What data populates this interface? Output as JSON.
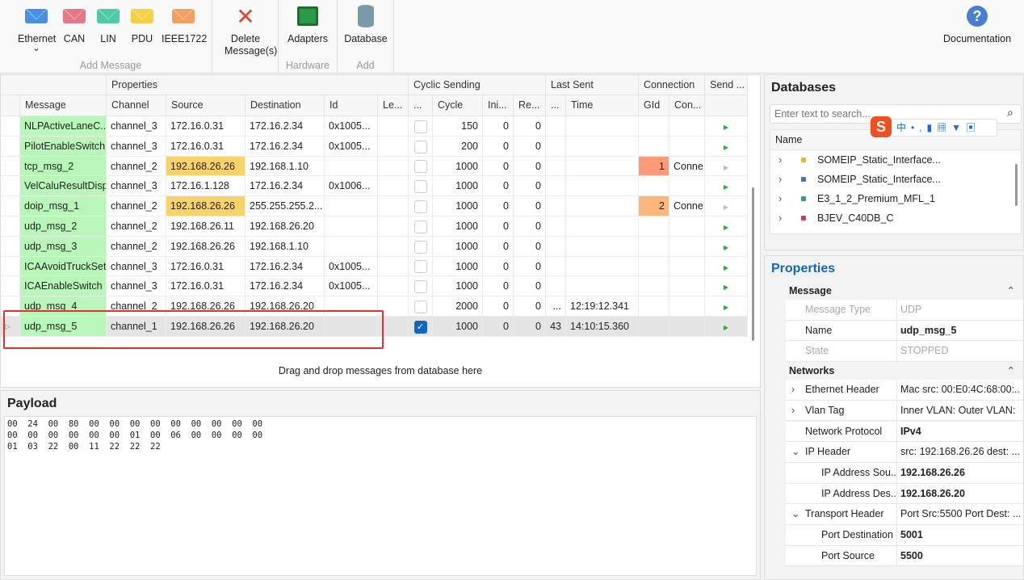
{
  "ribbon": {
    "groups": [
      {
        "label": "Add Message"
      },
      {
        "label": ""
      },
      {
        "label": "Hardware"
      },
      {
        "label": "Add"
      }
    ],
    "buttons": [
      {
        "label": "Ethernet",
        "icon": "ethernet-envelope-icon",
        "color": "#4a90e2",
        "dropdown": "⌄"
      },
      {
        "label": "CAN",
        "icon": "can-envelope-icon",
        "color": "#e57886"
      },
      {
        "label": "LIN",
        "icon": "lin-envelope-icon",
        "color": "#4fc9a8"
      },
      {
        "label": "PDU",
        "icon": "pdu-envelope-icon",
        "color": "#f4d046"
      },
      {
        "label": "IEEE1722",
        "icon": "ieee1722-envelope-icon",
        "color": "#f0a060"
      },
      {
        "label": "Delete Message(s)",
        "icon": "delete-x-icon",
        "color": "#e0452a"
      },
      {
        "label": "Adapters",
        "icon": "circuit-board-icon",
        "color": "#2a9a48"
      },
      {
        "label": "Database",
        "icon": "database-icon",
        "color": "#7a9aaa"
      },
      {
        "label": "Documentation",
        "icon": "help-icon",
        "color": "#4a7ed0"
      }
    ]
  },
  "grid": {
    "groups": [
      "Properties",
      "Cyclic Sending",
      "Last Sent",
      "Connection",
      "Send ..."
    ],
    "columns": [
      "Message",
      "Channel",
      "Source",
      "Destination",
      "Id",
      "Le...",
      "...",
      "Cycle",
      "Ini...",
      "Re...",
      "...",
      "Time",
      "GId",
      "Con..."
    ],
    "rows": [
      {
        "name": "NLPActiveLaneC...",
        "channel": "channel_3",
        "source": "172.16.0.31",
        "dest": "172.16.2.34",
        "id": "0x1005...",
        "cyclic": false,
        "cycle": "150",
        "ini": "0",
        "re": "0",
        "count": "",
        "time": "",
        "gid": "",
        "con": ""
      },
      {
        "name": "PilotEnableSwitch",
        "channel": "channel_3",
        "source": "172.16.0.31",
        "dest": "172.16.2.34",
        "id": "0x1005...",
        "cyclic": false,
        "cycle": "200",
        "ini": "0",
        "re": "0",
        "count": "",
        "time": "",
        "gid": "",
        "con": ""
      },
      {
        "name": "tcp_msg_2",
        "channel": "channel_2",
        "source": "192.168.26.26",
        "source_hl": true,
        "dest": "192.168.1.10",
        "id": "",
        "cyclic": false,
        "cycle": "1000",
        "ini": "0",
        "re": "0",
        "count": "",
        "time": "",
        "gid": "1",
        "gid_color": "#fd9a78",
        "con": "Conne",
        "send_disabled": true
      },
      {
        "name": "VelCaluResultDisp",
        "channel": "channel_3",
        "source": "172.16.1.128",
        "dest": "172.16.2.34",
        "id": "0x1006...",
        "cyclic": false,
        "cycle": "1000",
        "ini": "0",
        "re": "0",
        "count": "",
        "time": "",
        "gid": "",
        "con": ""
      },
      {
        "name": "doip_msg_1",
        "channel": "channel_2",
        "source": "192.168.26.26",
        "source_hl": true,
        "dest": "255.255.255.2...",
        "id": "",
        "cyclic": false,
        "cycle": "1000",
        "ini": "0",
        "re": "0",
        "count": "",
        "time": "",
        "gid": "2",
        "gid_color": "#fdb77a",
        "con": "Conne",
        "send_disabled": true
      },
      {
        "name": "udp_msg_2",
        "channel": "channel_2",
        "source": "192.168.26.11",
        "dest": "192.168.26.20",
        "id": "",
        "cyclic": false,
        "cycle": "1000",
        "ini": "0",
        "re": "0",
        "count": "",
        "time": "",
        "gid": "",
        "con": ""
      },
      {
        "name": "udp_msg_3",
        "channel": "channel_2",
        "source": "192.168.26.26",
        "dest": "192.168.1.10",
        "id": "",
        "cyclic": false,
        "cycle": "1000",
        "ini": "0",
        "re": "0",
        "count": "",
        "time": "",
        "gid": "",
        "con": ""
      },
      {
        "name": "ICAAvoidTruckSet",
        "channel": "channel_3",
        "source": "172.16.0.31",
        "dest": "172.16.2.34",
        "id": "0x1005...",
        "cyclic": false,
        "cycle": "1000",
        "ini": "0",
        "re": "0",
        "count": "",
        "time": "",
        "gid": "",
        "con": ""
      },
      {
        "name": "ICAEnableSwitch",
        "channel": "channel_3",
        "source": "172.16.0.31",
        "dest": "172.16.2.34",
        "id": "0x1005...",
        "cyclic": false,
        "cycle": "1000",
        "ini": "0",
        "re": "0",
        "count": "",
        "time": "",
        "gid": "",
        "con": ""
      },
      {
        "name": "udp_msg_4",
        "channel": "channel_2",
        "source": "192.168.26.26",
        "dest": "192.168.26.20",
        "id": "",
        "cyclic": false,
        "cycle": "2000",
        "ini": "0",
        "re": "0",
        "count": "...",
        "time": "12:19:12.341",
        "gid": "",
        "con": ""
      },
      {
        "name": "udp_msg_5",
        "channel": "channel_1",
        "source": "192.168.26.26",
        "dest": "192.168.26.20",
        "id": "",
        "cyclic": true,
        "cycle": "1000",
        "ini": "0",
        "re": "0",
        "count": "43",
        "time": "14:10:15.360",
        "gid": "",
        "con": "",
        "selected": true
      }
    ],
    "drop_hint": "Drag and drop messages from database here"
  },
  "payload": {
    "title": "Payload",
    "text": "00  24  00  80  00  00  00  00  00  00  00  00  00\n00  00  00  00  00  00  01  00  06  00  00  00  00\n01  03  22  00  11  22  22  22"
  },
  "databases": {
    "title": "Databases",
    "search_placeholder": "Enter text to search...",
    "column": "Name",
    "items": [
      {
        "label": "SOMEIP_Static_Interface...",
        "color": "#e8b830"
      },
      {
        "label": "SOMEIP_Static_Interface...",
        "color": "#4a70c8"
      },
      {
        "label": "E3_1_2_Premium_MFL_1",
        "color": "#2aa080"
      },
      {
        "label": "BJEV_C40DB_C",
        "color": "#d04050"
      }
    ]
  },
  "properties": {
    "title": "Properties",
    "sections": [
      {
        "label": "Message",
        "rows": [
          {
            "key": "Message Type",
            "value": "UDP",
            "muted": true
          },
          {
            "key": "Name",
            "value": "udp_msg_5",
            "bold": true
          },
          {
            "key": "State",
            "value": "STOPPED",
            "muted": true
          }
        ]
      },
      {
        "label": "Networks",
        "rows": [
          {
            "key": "Ethernet Header",
            "value": "Mac src: 00:E0:4C:68:00:...",
            "exp": ">"
          },
          {
            "key": "Vlan Tag",
            "value": "Inner VLAN:  Outer VLAN:",
            "exp": ">"
          },
          {
            "key": "Network Protocol",
            "value": "IPv4",
            "bold": true
          },
          {
            "key": "IP Header",
            "value": "src: 192.168.26.26 dest: ...",
            "exp": "⌄"
          },
          {
            "key": "IP Address Sou...",
            "value": "192.168.26.26",
            "bold": true,
            "indent": true
          },
          {
            "key": "IP Address Des...",
            "value": "192.168.26.20",
            "bold": true,
            "indent": true
          },
          {
            "key": "Transport Header",
            "value": "Port Src:5500 Port Dest: ...",
            "exp": "⌄"
          },
          {
            "key": "Port Destination",
            "value": "5001",
            "bold": true,
            "indent": true
          },
          {
            "key": "Port Source",
            "value": "5500",
            "bold": true,
            "indent": true
          }
        ]
      }
    ]
  },
  "colors": {
    "message_cell": "#b9f6b9",
    "highlight_source": "#f8d26a",
    "selection_outline": "#e53030",
    "accent": "#1565c0"
  }
}
